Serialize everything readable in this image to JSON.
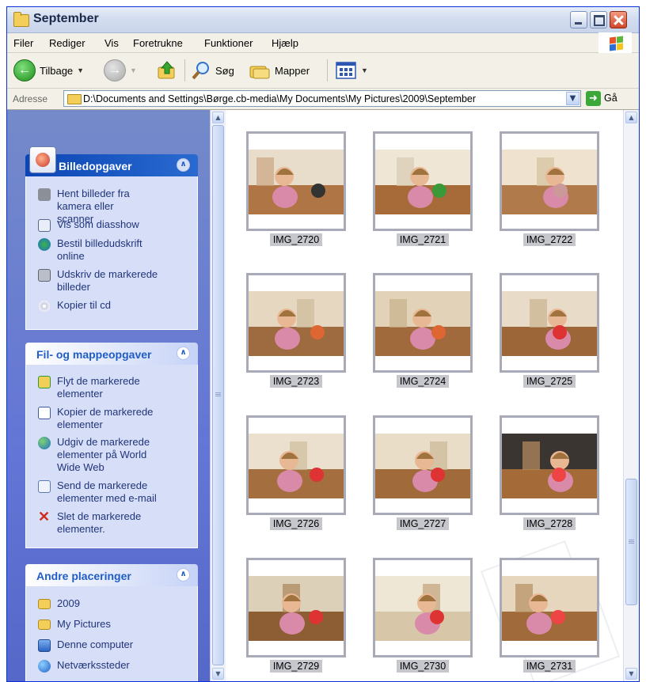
{
  "window": {
    "title": "September"
  },
  "menu": {
    "items": [
      "Filer",
      "Rediger",
      "Vis",
      "Foretrukne",
      "Funktioner",
      "Hjælp"
    ]
  },
  "toolbar": {
    "back_label": "Tilbage",
    "search_label": "Søg",
    "folders_label": "Mapper"
  },
  "address": {
    "label": "Adresse",
    "path": "D:\\Documents and Settings\\Børge.cb-media\\My Documents\\My Pictures\\2009\\September",
    "go_label": "Gå"
  },
  "taskpane": {
    "picture_tasks": {
      "title": "Billedopgaver",
      "items": [
        {
          "label": "Hent billeder fra kamera eller scanner",
          "icon": "camera-icon"
        },
        {
          "label": "Vis som diasshow",
          "icon": "slideshow-icon"
        },
        {
          "label": "Bestil billedudskrift online",
          "icon": "online-print-icon"
        },
        {
          "label": "Udskriv de markerede billeder",
          "icon": "printer-icon"
        },
        {
          "label": "Kopier til cd",
          "icon": "cd-icon"
        }
      ]
    },
    "file_tasks": {
      "title": "Fil- og mappeopgaver",
      "items": [
        {
          "label": "Flyt de markerede elementer",
          "icon": "move-icon"
        },
        {
          "label": "Kopier de markerede elementer",
          "icon": "copy-icon"
        },
        {
          "label": "Udgiv de markerede elementer på World Wide Web",
          "icon": "globe-icon"
        },
        {
          "label": "Send de markerede elementer med e-mail",
          "icon": "email-icon"
        },
        {
          "label": "Slet de markerede elementer.",
          "icon": "delete-icon"
        }
      ]
    },
    "other_places": {
      "title": "Andre placeringer",
      "items": [
        {
          "label": "2009",
          "icon": "folder-icon"
        },
        {
          "label": "My Pictures",
          "icon": "folder-icon"
        },
        {
          "label": "Denne computer",
          "icon": "computer-icon"
        },
        {
          "label": "Netværkssteder",
          "icon": "network-icon"
        }
      ]
    }
  },
  "files": [
    {
      "name": "IMG_2720",
      "selected": true
    },
    {
      "name": "IMG_2721",
      "selected": true
    },
    {
      "name": "IMG_2722",
      "selected": true
    },
    {
      "name": "IMG_2723",
      "selected": true
    },
    {
      "name": "IMG_2724",
      "selected": true
    },
    {
      "name": "IMG_2725",
      "selected": true
    },
    {
      "name": "IMG_2726",
      "selected": true
    },
    {
      "name": "IMG_2727",
      "selected": true
    },
    {
      "name": "IMG_2728",
      "selected": true
    },
    {
      "name": "IMG_2729",
      "selected": true
    },
    {
      "name": "IMG_2730",
      "selected": true
    },
    {
      "name": "IMG_2731",
      "selected": true
    }
  ],
  "colors": {
    "taskpane_bg": "#6375d6",
    "panel_body": "#d6dff7",
    "special_header": "#0c46b5",
    "task_link": "#21347a",
    "selection": "#c6c7cd"
  }
}
